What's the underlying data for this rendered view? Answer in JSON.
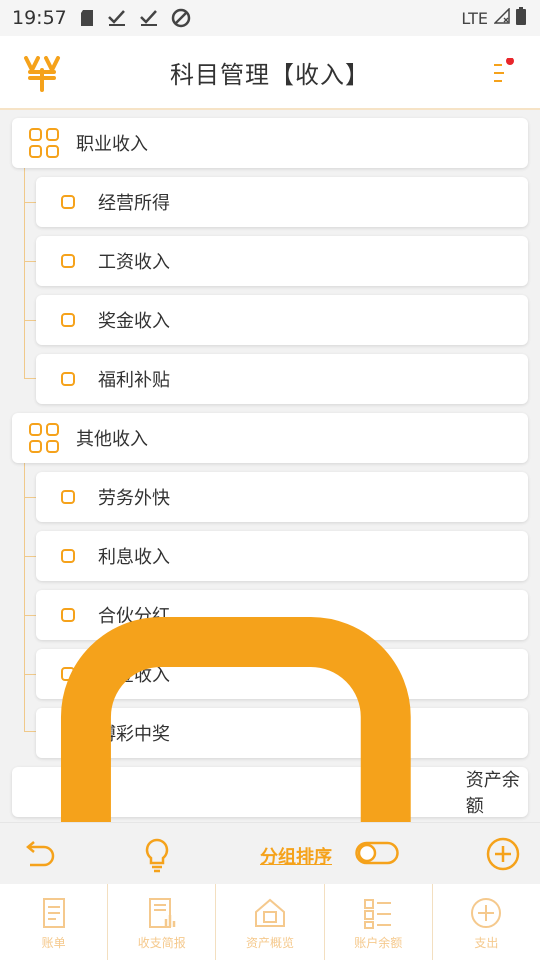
{
  "status_bar": {
    "time": "19:57",
    "network": "LTE"
  },
  "header": {
    "title": "科目管理【收入】"
  },
  "categories": [
    {
      "label": "职业收入",
      "items": [
        "经营所得",
        "工资收入",
        "奖金收入",
        "福利补贴"
      ]
    },
    {
      "label": "其他收入",
      "items": [
        "劳务外快",
        "利息收入",
        "合伙分红",
        "礼金收入",
        "博彩中奖"
      ]
    }
  ],
  "standalone_items": [
    "资产余额"
  ],
  "toolbar": {
    "sort_label": "分组排序"
  },
  "tabs": [
    {
      "label": "账单",
      "icon": "bill-icon"
    },
    {
      "label": "收支简报",
      "icon": "report-icon"
    },
    {
      "label": "资产概览",
      "icon": "assets-icon"
    },
    {
      "label": "账户余额",
      "icon": "account-icon"
    },
    {
      "label": "支出",
      "icon": "plus-circle-icon"
    }
  ],
  "colors": {
    "accent": "#f5a21b",
    "light_accent": "#f5c98d",
    "background": "#f2f2f2"
  }
}
